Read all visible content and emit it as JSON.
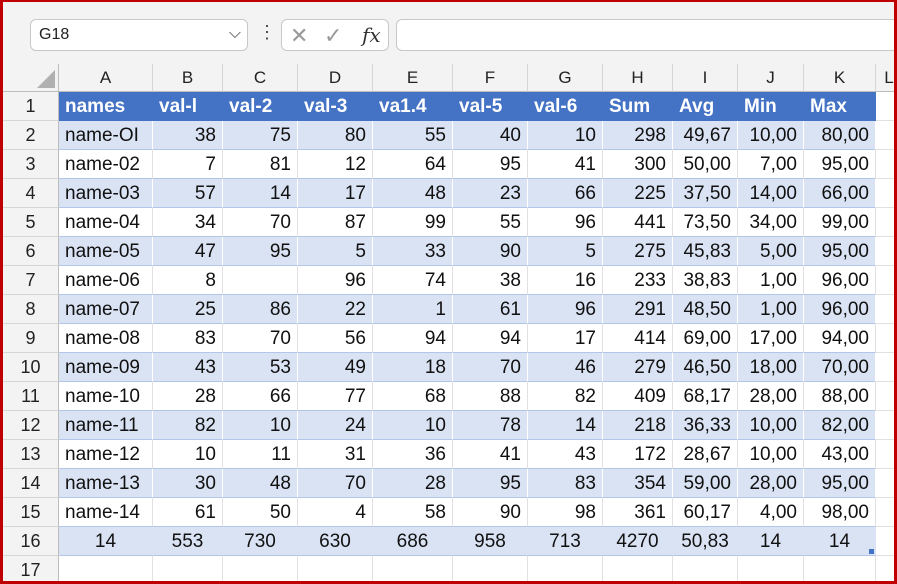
{
  "namebox": {
    "value": "G18"
  },
  "formula_bar": {
    "value": ""
  },
  "columns": [
    "A",
    "B",
    "C",
    "D",
    "E",
    "F",
    "G",
    "H",
    "I",
    "J",
    "K",
    "L"
  ],
  "table": {
    "headers": [
      "names",
      "val-l",
      "val-2",
      "val-3",
      "va1.4",
      "val-5",
      "val-6",
      "Sum",
      "Avg",
      "Min",
      "Max"
    ],
    "rows": [
      [
        "name-OI",
        "38",
        "75",
        "80",
        "55",
        "40",
        "10",
        "298",
        "49,67",
        "10,00",
        "80,00"
      ],
      [
        "name-02",
        "7",
        "81",
        "12",
        "64",
        "95",
        "41",
        "300",
        "50,00",
        "7,00",
        "95,00"
      ],
      [
        "name-03",
        "57",
        "14",
        "17",
        "48",
        "23",
        "66",
        "225",
        "37,50",
        "14,00",
        "66,00"
      ],
      [
        "name-04",
        "34",
        "70",
        "87",
        "99",
        "55",
        "96",
        "441",
        "73,50",
        "34,00",
        "99,00"
      ],
      [
        "name-05",
        "47",
        "95",
        "5",
        "33",
        "90",
        "5",
        "275",
        "45,83",
        "5,00",
        "95,00"
      ],
      [
        "name-06",
        "8",
        "",
        "96",
        "74",
        "38",
        "16",
        "233",
        "38,83",
        "1,00",
        "96,00"
      ],
      [
        "name-07",
        "25",
        "86",
        "22",
        "1",
        "61",
        "96",
        "291",
        "48,50",
        "1,00",
        "96,00"
      ],
      [
        "name-08",
        "83",
        "70",
        "56",
        "94",
        "94",
        "17",
        "414",
        "69,00",
        "17,00",
        "94,00"
      ],
      [
        "name-09",
        "43",
        "53",
        "49",
        "18",
        "70",
        "46",
        "279",
        "46,50",
        "18,00",
        "70,00"
      ],
      [
        "name-10",
        "28",
        "66",
        "77",
        "68",
        "88",
        "82",
        "409",
        "68,17",
        "28,00",
        "88,00"
      ],
      [
        "name-11",
        "82",
        "10",
        "24",
        "10",
        "78",
        "14",
        "218",
        "36,33",
        "10,00",
        "82,00"
      ],
      [
        "name-12",
        "10",
        "11",
        "31",
        "36",
        "41",
        "43",
        "172",
        "28,67",
        "10,00",
        "43,00"
      ],
      [
        "name-13",
        "30",
        "48",
        "70",
        "28",
        "95",
        "83",
        "354",
        "59,00",
        "28,00",
        "95,00"
      ],
      [
        "name-14",
        "61",
        "50",
        "4",
        "58",
        "90",
        "98",
        "361",
        "60,17",
        "4,00",
        "98,00"
      ]
    ],
    "totals": [
      "14",
      "553",
      "730",
      "630",
      "686",
      "958",
      "713",
      "4270",
      "50,83",
      "14",
      "14"
    ]
  },
  "row_numbers": [
    "1",
    "2",
    "3",
    "4",
    "5",
    "6",
    "7",
    "8",
    "9",
    "10",
    "11",
    "12",
    "13",
    "14",
    "15",
    "16",
    "17"
  ],
  "colors": {
    "header_fill": "#4472c4",
    "band_fill": "#dae3f3",
    "frame": "#c00000"
  }
}
